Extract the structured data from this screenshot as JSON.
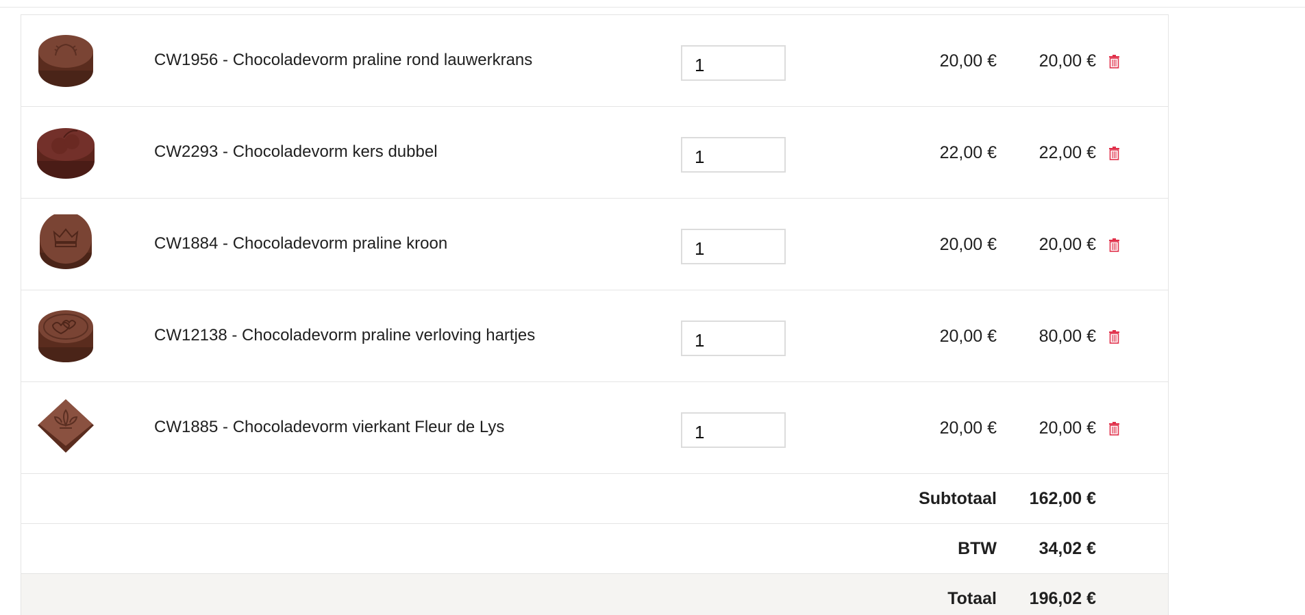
{
  "cart": {
    "currency_note": "€",
    "items": [
      {
        "name": "CW1956 - Chocoladevorm praline rond lauwerkrans",
        "qty": "1",
        "price": "20,00 €",
        "total": "20,00 €",
        "image": "praline-round-laurel"
      },
      {
        "name": "CW2293 - Chocoladevorm kers dubbel",
        "qty": "1",
        "price": "22,00 €",
        "total": "22,00 €",
        "image": "praline-cherry-double"
      },
      {
        "name": "CW1884 - Chocoladevorm praline kroon",
        "qty": "1",
        "price": "20,00 €",
        "total": "20,00 €",
        "image": "praline-crown"
      },
      {
        "name": "CW12138 - Chocoladevorm praline verloving hartjes",
        "qty": "1",
        "price": "20,00 €",
        "total": "80,00 €",
        "image": "praline-hearts"
      },
      {
        "name": "CW1885 - Chocoladevorm vierkant Fleur de Lys",
        "qty": "1",
        "price": "20,00 €",
        "total": "20,00 €",
        "image": "praline-square-fleur-de-lys"
      }
    ],
    "summary": {
      "subtotal_label": "Subtotaal",
      "subtotal_value": "162,00 €",
      "vat_label": "BTW",
      "vat_value": "34,02 €",
      "total_label": "Totaal",
      "total_value": "196,02 €"
    },
    "colors": {
      "trash": "#e0304a",
      "chocolate": "#6b3a2a",
      "total_row_bg": "#f5f4f2"
    }
  }
}
